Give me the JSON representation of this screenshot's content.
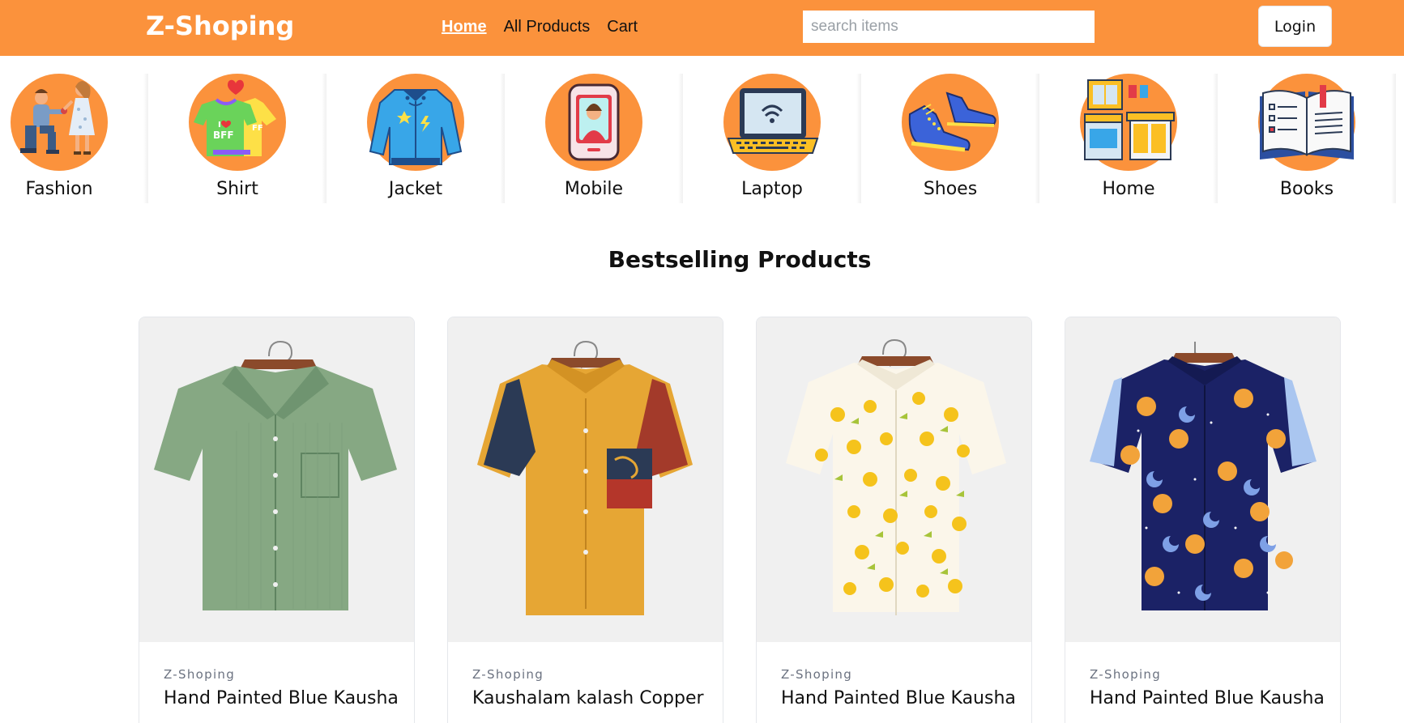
{
  "header": {
    "brand": "Z-Shoping",
    "nav": [
      {
        "label": "Home"
      },
      {
        "label": "All Products"
      },
      {
        "label": "Cart"
      }
    ],
    "search": {
      "placeholder": "search items",
      "value": ""
    },
    "login_label": "Login"
  },
  "categories": [
    {
      "label": "Fashion",
      "icon": "couple-proposal-icon"
    },
    {
      "label": "Shirt",
      "icon": "bff-tshirts-icon"
    },
    {
      "label": "Jacket",
      "icon": "jacket-icon"
    },
    {
      "label": "Mobile",
      "icon": "mobile-phone-icon"
    },
    {
      "label": "Laptop",
      "icon": "laptop-icon"
    },
    {
      "label": "Shoes",
      "icon": "shoes-icon"
    },
    {
      "label": "Home",
      "icon": "kitchen-appliances-icon"
    },
    {
      "label": "Books",
      "icon": "open-book-icon"
    }
  ],
  "section_title": "Bestselling Products",
  "products": [
    {
      "brand": "Z-Shoping",
      "title": "Hand Painted Blue Kausha",
      "image": "green-corduroy-shirt"
    },
    {
      "brand": "Z-Shoping",
      "title": "Kaushalam kalash Copper",
      "image": "mustard-patchwork-shirt"
    },
    {
      "brand": "Z-Shoping",
      "title": "Hand Painted Blue Kausha",
      "image": "lemon-print-shirt"
    },
    {
      "brand": "Z-Shoping",
      "title": "Hand Painted Blue Kausha",
      "image": "sun-moon-print-shirt"
    }
  ],
  "colors": {
    "header_bg": "#fb923c",
    "category_circle": "#fb923c",
    "card_image_bg": "#f0f0f0",
    "brand_text": "#6b7280"
  }
}
